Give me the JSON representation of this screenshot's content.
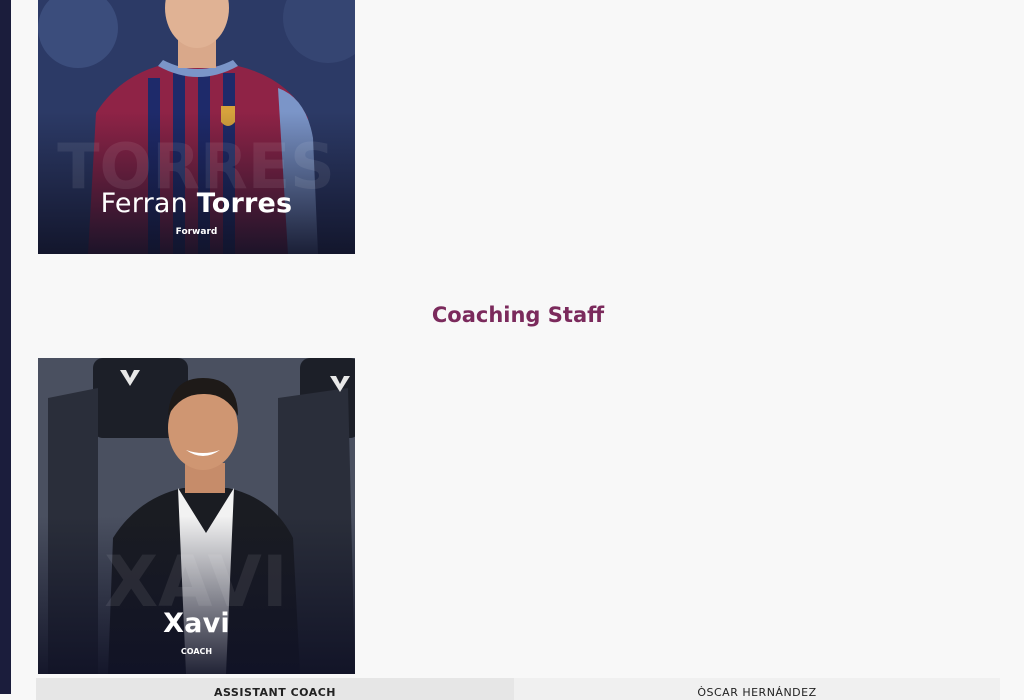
{
  "player_card": {
    "first_name": "Ferran",
    "last_name": "Torres",
    "position": "Forward"
  },
  "section": {
    "title": "Coaching Staff"
  },
  "coach_card": {
    "name": "Xavi",
    "role": "COACH"
  },
  "staff_table": {
    "role": "ASSISTANT COACH",
    "name": "ÒSCAR HERNÁNDEZ"
  },
  "colors": {
    "section_title": "#7b2a5c",
    "left_rail": "#1b1d3c"
  }
}
